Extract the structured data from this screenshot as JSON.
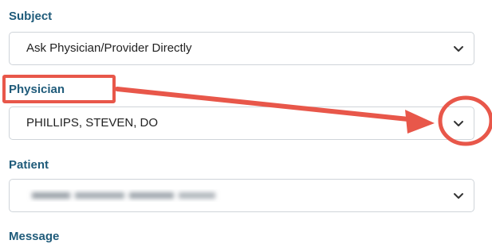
{
  "form": {
    "subject": {
      "label": "Subject",
      "value": "Ask Physician/Provider Directly"
    },
    "physician": {
      "label": "Physician",
      "value": "PHILLIPS, STEVEN, DO"
    },
    "patient": {
      "label": "Patient",
      "value_redacted": true
    },
    "message": {
      "label": "Message"
    }
  },
  "icons": {
    "dropdown": "chevron-down-icon"
  },
  "colors": {
    "label": "#1f5b7a",
    "annotation": "#e8574a",
    "border": "#cfd4d9"
  }
}
